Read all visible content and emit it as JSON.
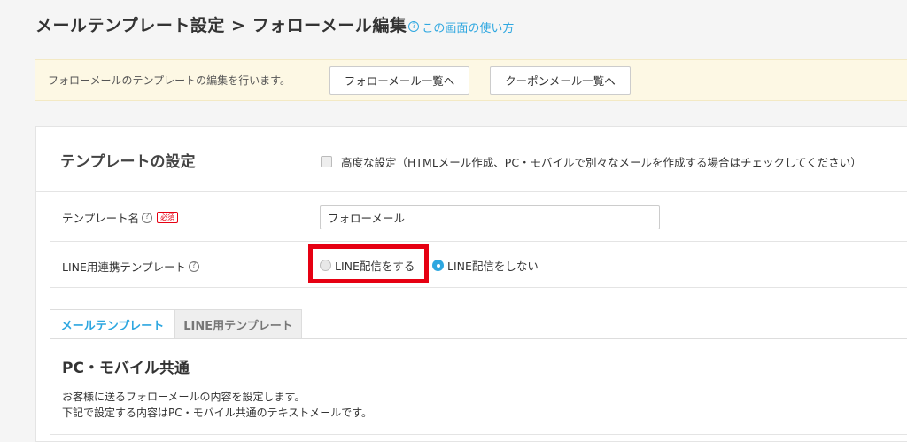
{
  "header": {
    "title": "メールテンプレート設定 > フォローメール編集",
    "help_link": "この画面の使い方"
  },
  "notice": {
    "text": "フォローメールのテンプレートの編集を行います。",
    "follow_list_button": "フォローメール一覧へ",
    "coupon_list_button": "クーポンメール一覧へ"
  },
  "template_settings": {
    "title": "テンプレートの設定",
    "advanced_checkbox_label": "高度な設定（HTMLメール作成、PC・モバイルで別々なメールを作成する場合はチェックしてください）",
    "advanced_checked": false,
    "name_label": "テンプレート名",
    "required_badge": "必須",
    "name_value": "フォローメール",
    "line_label": "LINE用連携テンプレート",
    "line_option_send": "LINE配信をする",
    "line_option_nosend": "LINE配信をしない",
    "line_selected": "LINE配信をしない"
  },
  "tabs": [
    {
      "label": "メールテンプレート",
      "active": true
    },
    {
      "label": "LINE用テンプレート",
      "active": false
    }
  ],
  "content": {
    "section_title": "PC・モバイル共通",
    "desc_line1": "お客様に送るフォローメールの内容を設定します。",
    "desc_line2": "下記で設定する内容はPC・モバイル共通のテキストメールです。"
  },
  "colors": {
    "accent": "#2ea7e0",
    "highlight": "#e60012",
    "notice_bg": "#fdf8e4"
  },
  "icons": {
    "help": "question-circle-icon"
  }
}
